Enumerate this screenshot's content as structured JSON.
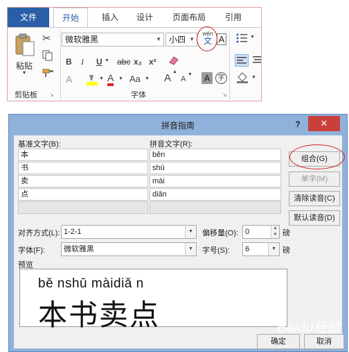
{
  "ribbon": {
    "tabs": [
      "文件",
      "开始",
      "插入",
      "设计",
      "页面布局",
      "引用"
    ],
    "font_name": "微软雅黑",
    "font_size": "小四",
    "paste_label": "粘贴",
    "clipboard_group": "剪贴板",
    "font_group": "字体",
    "bold": "B",
    "italic": "I",
    "underline": "U",
    "strike": "abc",
    "subscript": "x₂",
    "superscript": "x²",
    "big_a": "A",
    "aa": "Aa",
    "grow": "A",
    "shrink": "A",
    "char_shade": "A",
    "enclose": "字",
    "phonetic_top": "wén",
    "phonetic_bottom": "文",
    "accent_color": "#2a5fa8"
  },
  "dialog": {
    "title": "拼音指南",
    "help": "?",
    "close": "✕",
    "base_text_label": "基准文字(B):",
    "ruby_text_label": "拼音文字(R):",
    "rows": [
      {
        "base": "本",
        "ruby": "běn"
      },
      {
        "base": "书",
        "ruby": "shū"
      },
      {
        "base": "卖",
        "ruby": "mài"
      },
      {
        "base": "点",
        "ruby": "diǎn"
      }
    ],
    "buttons": {
      "group": "组合(G)",
      "mono": "单字(M)",
      "clear": "清除读音(C)",
      "default": "默认读音(D)",
      "ok": "确定",
      "cancel": "取消"
    },
    "alignment_label": "对齐方式(L):",
    "alignment_value": "1-2-1",
    "offset_label": "偏移量(O):",
    "offset_value": "0",
    "offset_unit": "磅",
    "font_label": "字体(F):",
    "font_value": "微软雅黑",
    "size_label": "字号(S):",
    "size_value": "6",
    "size_unit": "磅",
    "preview_label": "预览",
    "preview_pinyin": "bě nshū màidiǎ n",
    "preview_hanzi": "本书卖点"
  },
  "watermark": "Baidu经验"
}
